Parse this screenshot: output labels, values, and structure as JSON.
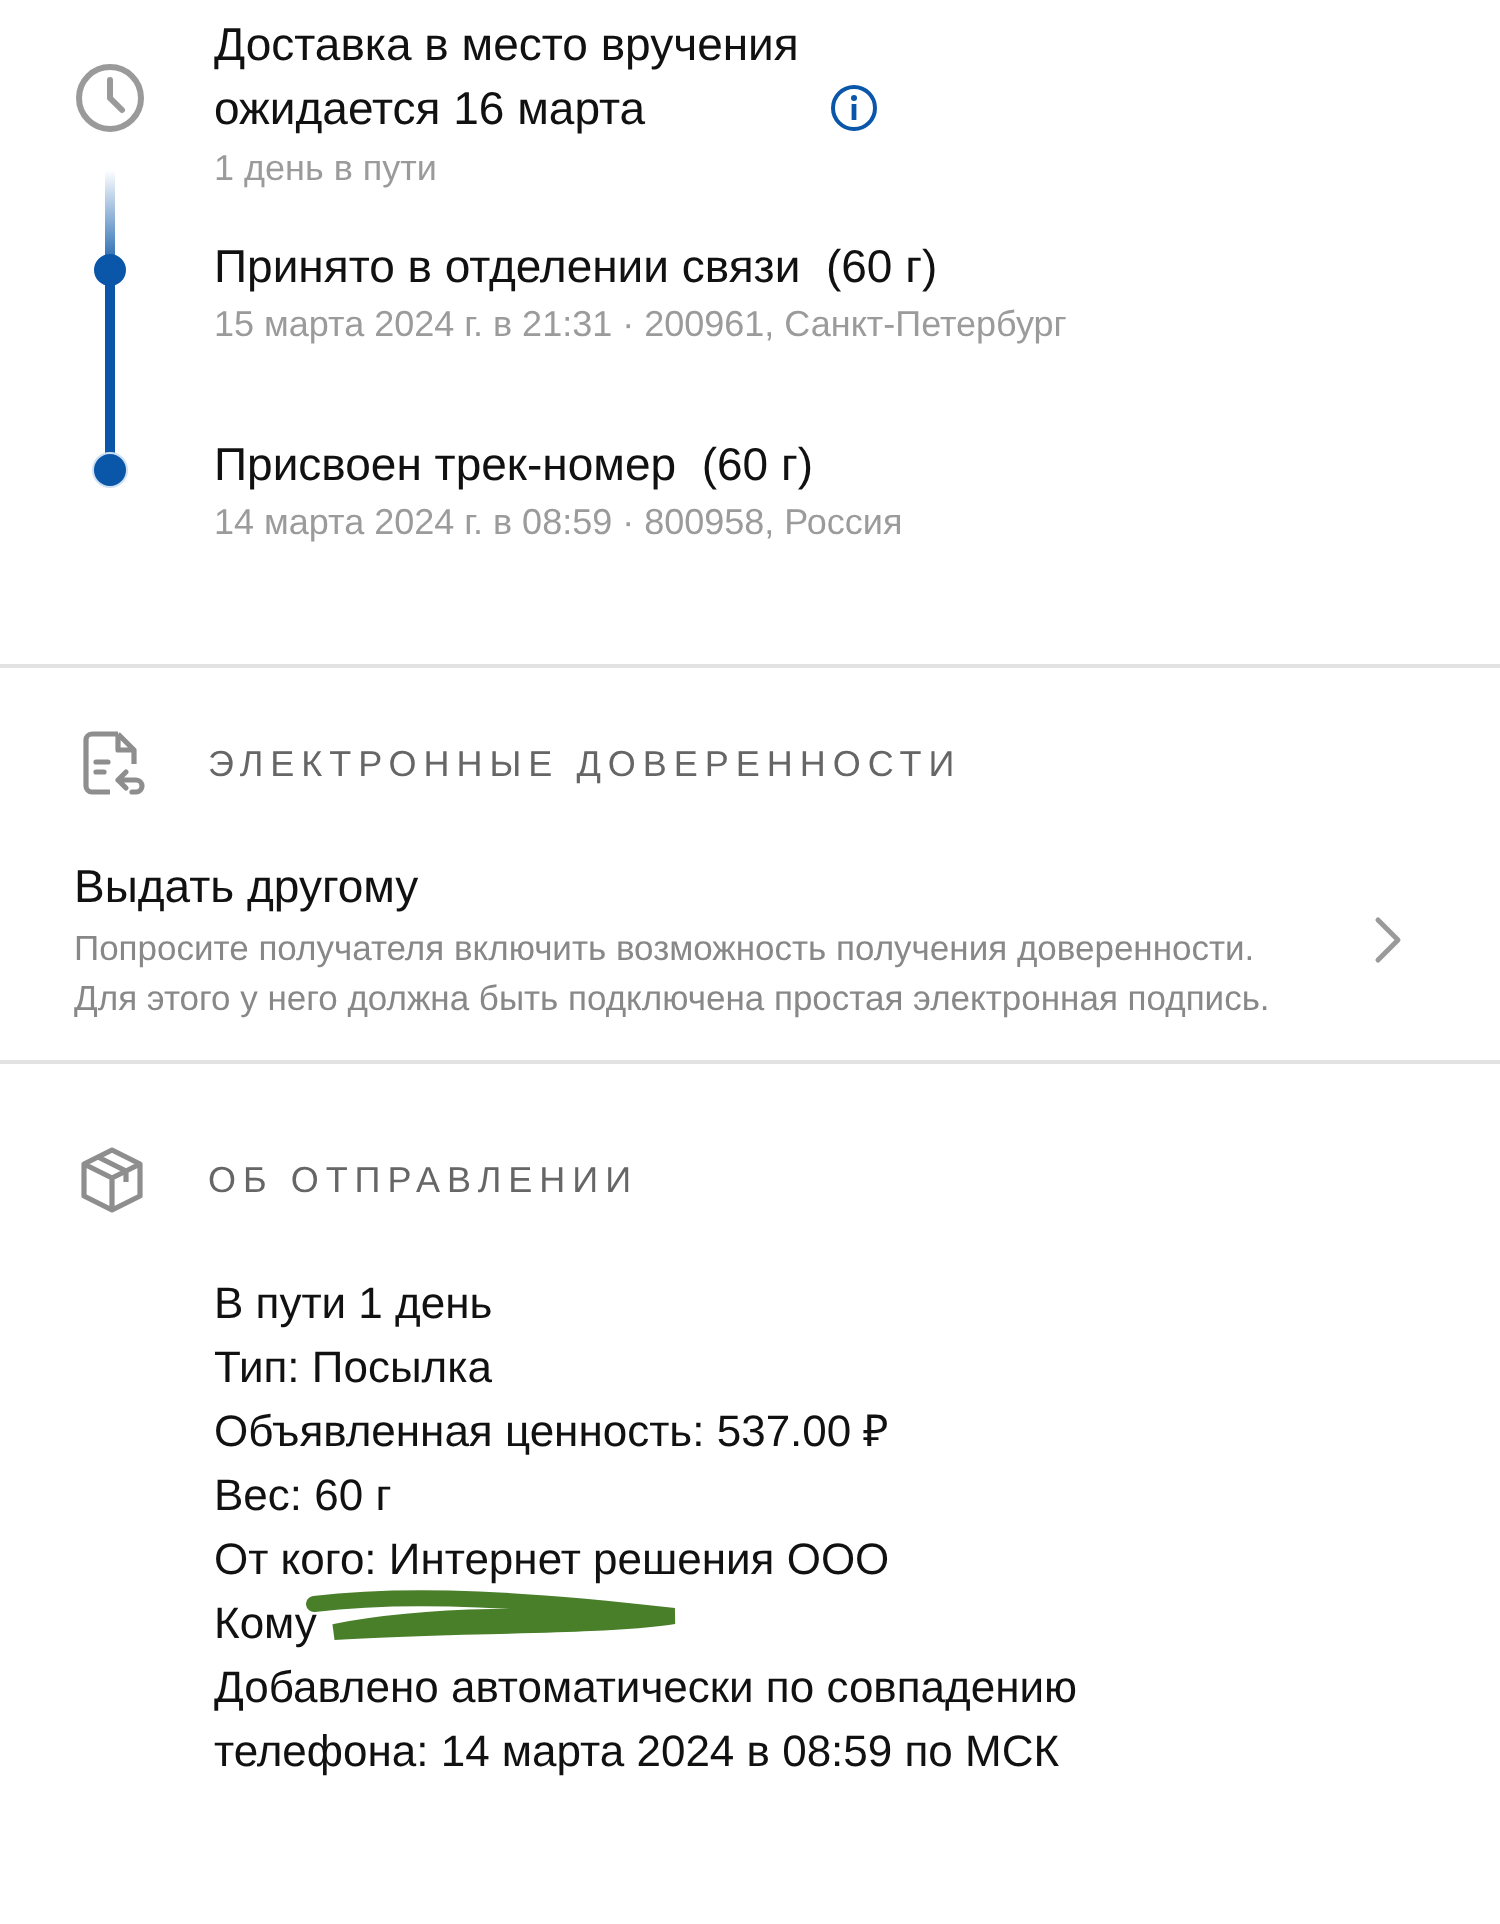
{
  "tracking": {
    "eta_title": "Доставка в место вручения ожидается 16 марта",
    "eta_subtitle": "1 день в пути",
    "events": [
      {
        "title": "Принято в отделении связи  (60 г)",
        "details": "15 марта 2024 г. в 21:31 · 200961, Санкт-Петербург",
        "completed": true
      },
      {
        "title": "Присвоен трек-номер  (60 г)",
        "details": "14 марта 2024 г. в 08:59 · 800958, Россия",
        "completed": true
      }
    ]
  },
  "proxy": {
    "heading": "ЭЛЕКТРОННЫЕ ДОВЕРЕННОСТИ",
    "title": "Выдать другому",
    "description": "Попросите получателя включить возможность получения доверенности. Для этого у него должна быть подключена простая электронная подпись."
  },
  "shipment": {
    "heading": "ОБ ОТПРАВЛЕНИИ",
    "lines": [
      {
        "text": "В пути 1 день",
        "redacted": false
      },
      {
        "text": "Тип: Посылка",
        "redacted": false
      },
      {
        "text": "Объявленная ценность: 537.00 ₽",
        "redacted": false
      },
      {
        "text": "Вес: 60 г",
        "redacted": false
      },
      {
        "text": "От кого: Интернет решения ООО",
        "redacted": false
      },
      {
        "text": "Кому",
        "redacted": true
      },
      {
        "text": "Добавлено автоматически по совпадению телефона: 14 марта 2024 в 08:59 по МСК",
        "redacted": false
      }
    ]
  }
}
